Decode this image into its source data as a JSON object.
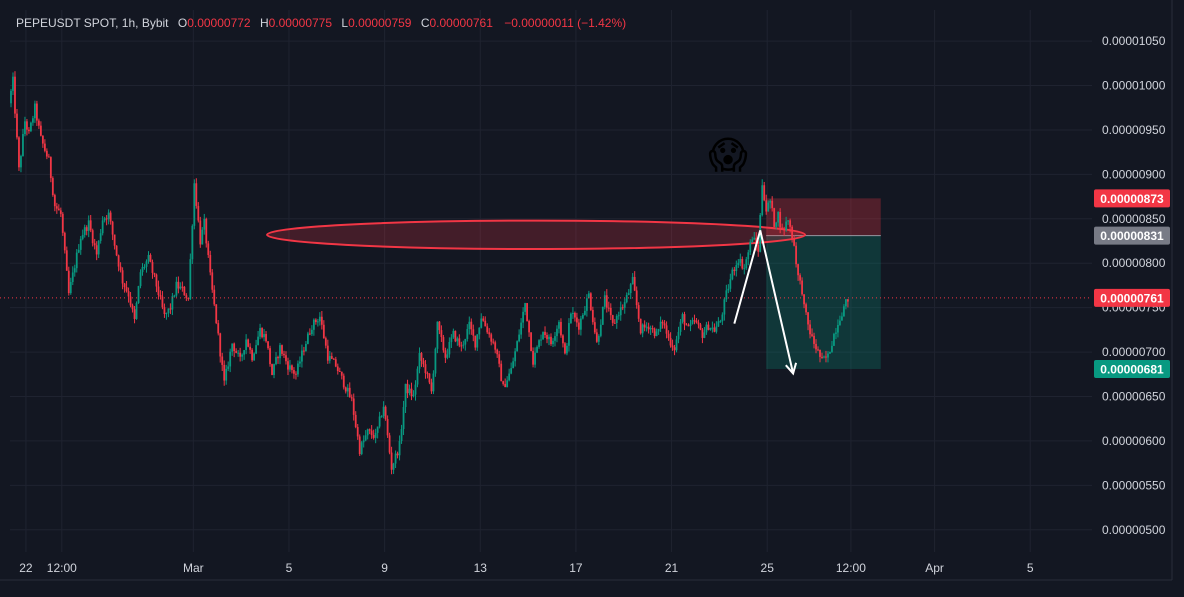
{
  "legend": {
    "symbol": "PEPEUSDT SPOT, 1h, Bybit",
    "o_label": "O",
    "o_value": "0.00000772",
    "h_label": "H",
    "h_value": "0.00000775",
    "l_label": "L",
    "l_value": "0.00000759",
    "c_label": "C",
    "c_value": "0.00000761",
    "change": "−0.00000011 (−1.42%)"
  },
  "colors": {
    "background": "#131722",
    "grid": "#1f2330",
    "up": "#089981",
    "down": "#f23645",
    "axis_text": "#d1d4dc",
    "last_price_badge": "#f23645",
    "entry_badge": "#787b86",
    "target_badge": "#089981",
    "stop_badge": "#f23645",
    "ellipse": "#f23645"
  },
  "emoji": "😱",
  "chart_data": {
    "type": "candlestick",
    "title": "",
    "ylim": [
      4.75e-06,
      1.085e-05
    ],
    "y_ticks": [
      "0.00001050",
      "0.00001000",
      "0.00000950",
      "0.00000900",
      "0.00000850",
      "0.00000800",
      "0.00000750",
      "0.00000700",
      "0.00000650",
      "0.00000600",
      "0.00000550",
      "0.00000500"
    ],
    "y_tick_values": [
      1.05e-05,
      1e-05,
      9.5e-06,
      9e-06,
      8.5e-06,
      8e-06,
      7.5e-06,
      7e-06,
      6.5e-06,
      6e-06,
      5.5e-06,
      5e-06
    ],
    "x_ticks": [
      "22",
      "12:00",
      "Mar",
      "5",
      "9",
      "13",
      "17",
      "21",
      "25",
      "12:00",
      "Apr",
      "5"
    ],
    "x_tick_hours": [
      0,
      36,
      168,
      264,
      360,
      456,
      552,
      648,
      744,
      828,
      912,
      1008
    ],
    "x_hour_range": [
      -16,
      1070
    ],
    "grid": true,
    "last_price": {
      "label": "0.00000761",
      "value": 7.61e-06
    },
    "position": {
      "stop_label": "0.00000873",
      "stop": 8.73e-06,
      "entry_label": "0.00000831",
      "entry": 8.31e-06,
      "target_label": "0.00000681",
      "target": 6.81e-06,
      "start_hour": 743,
      "end_hour": 858
    },
    "ellipse_zone": {
      "center_hour": 512,
      "center_value": 8.32e-06,
      "half_width_hours": 270,
      "half_height": 1.6e-07
    },
    "arrow_path": {
      "hours": [
        711,
        737,
        770
      ],
      "values": [
        7.32e-06,
        8.37e-06,
        6.76e-06
      ]
    },
    "anchors": {
      "hours": [
        -16,
        -12,
        -6,
        0,
        4,
        10,
        16,
        24,
        30,
        36,
        44,
        56,
        64,
        72,
        78,
        84,
        92,
        98,
        104,
        110,
        116,
        124,
        132,
        140,
        146,
        152,
        158,
        164,
        170,
        176,
        180,
        186,
        192,
        200,
        208,
        216,
        222,
        228,
        236,
        242,
        248,
        256,
        264,
        272,
        280,
        288,
        296,
        304,
        312,
        320,
        328,
        336,
        344,
        352,
        360,
        368,
        376,
        382,
        390,
        396,
        402,
        408,
        414,
        422,
        430,
        438,
        446,
        452,
        458,
        466,
        472,
        480,
        488,
        494,
        502,
        510,
        520,
        528,
        536,
        542,
        548,
        556,
        566,
        574,
        582,
        590,
        596,
        602,
        610,
        618,
        626,
        634,
        640,
        646,
        652,
        660,
        666,
        672,
        680,
        686,
        692,
        698,
        704,
        710,
        716,
        722,
        730,
        736,
        740,
        744,
        748,
        752,
        756,
        760,
        766,
        772,
        776,
        780,
        782,
        786,
        790,
        794,
        800,
        806,
        812,
        818,
        826,
        832,
        838,
        844,
        850,
        856,
        862,
        868,
        874,
        880,
        886,
        892,
        898,
        904,
        910,
        916,
        920
      ],
      "values": [
        9.8,
        10.05,
        9.05,
        9.6,
        9.45,
        9.75,
        9.4,
        9.15,
        8.65,
        8.55,
        7.65,
        8.3,
        8.45,
        8.1,
        8.5,
        8.55,
        8.1,
        7.8,
        7.65,
        7.35,
        7.9,
        8.05,
        7.75,
        7.4,
        7.5,
        7.75,
        7.7,
        7.6,
        8.9,
        8.25,
        8.45,
        7.85,
        7.35,
        6.65,
        7.1,
        6.9,
        7.15,
        6.95,
        7.25,
        7.15,
        6.75,
        7.05,
        6.85,
        6.75,
        7.05,
        7.3,
        7.4,
        6.95,
        6.85,
        6.65,
        6.45,
        5.9,
        6.1,
        6.05,
        6.4,
        5.7,
        5.95,
        6.6,
        6.5,
        6.95,
        6.8,
        6.55,
        7.3,
        6.95,
        7.2,
        7.05,
        7.3,
        7.1,
        7.4,
        7.2,
        7.05,
        6.6,
        6.8,
        7.1,
        7.55,
        6.9,
        7.25,
        7.1,
        7.35,
        6.95,
        7.45,
        7.3,
        7.65,
        7.1,
        7.6,
        7.3,
        7.45,
        7.55,
        7.8,
        7.25,
        7.3,
        7.2,
        7.35,
        7.15,
        7.05,
        7.4,
        7.25,
        7.35,
        7.2,
        7.3,
        7.25,
        7.35,
        7.65,
        7.9,
        8.05,
        7.95,
        8.3,
        8.15,
        8.9,
        8.6,
        8.7,
        8.45,
        8.55,
        8.35,
        8.5,
        8.2,
        7.85,
        7.7,
        7.5,
        7.3,
        7.15,
        7.05,
        6.9,
        6.95,
        7.2,
        7.4,
        7.6
      ],
      "value_scale": 1e-06
    }
  }
}
